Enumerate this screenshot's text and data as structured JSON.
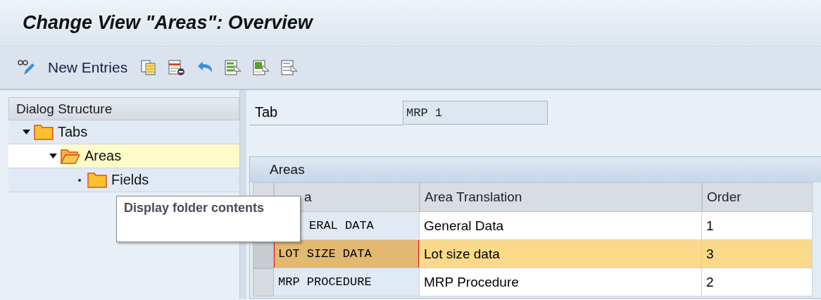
{
  "window": {
    "title": "Change View \"Areas\": Overview"
  },
  "toolbar": {
    "items": [
      {
        "kind": "icon"
      },
      {
        "kind": "text",
        "label": "New Entries"
      },
      {
        "kind": "icon"
      },
      {
        "kind": "icon"
      },
      {
        "kind": "icon"
      },
      {
        "kind": "icon"
      },
      {
        "kind": "icon"
      },
      {
        "kind": "icon"
      }
    ]
  },
  "sidebar": {
    "title": "Dialog Structure",
    "items": [
      {
        "label": "Tabs",
        "expanded": true,
        "selected": false,
        "children": [
          {
            "label": "Areas",
            "expanded": true,
            "selected": true,
            "children": [
              {
                "label": "Fields",
                "expanded": false,
                "selected": false
              }
            ]
          }
        ]
      }
    ]
  },
  "tooltip": {
    "text": "Display folder contents"
  },
  "form": {
    "label": "Tab",
    "value": "MRP 1"
  },
  "table": {
    "title": "Areas",
    "columns": [
      "a",
      "Area Translation",
      "Order"
    ],
    "rows": [
      {
        "selected": false,
        "cells": [
          "ERAL DATA",
          "General Data",
          "1"
        ]
      },
      {
        "selected": true,
        "cells": [
          "LOT SIZE DATA",
          "Lot size data",
          "3"
        ]
      },
      {
        "selected": false,
        "cells": [
          "MRP PROCEDURE",
          "MRP Procedure",
          "2"
        ]
      }
    ]
  }
}
